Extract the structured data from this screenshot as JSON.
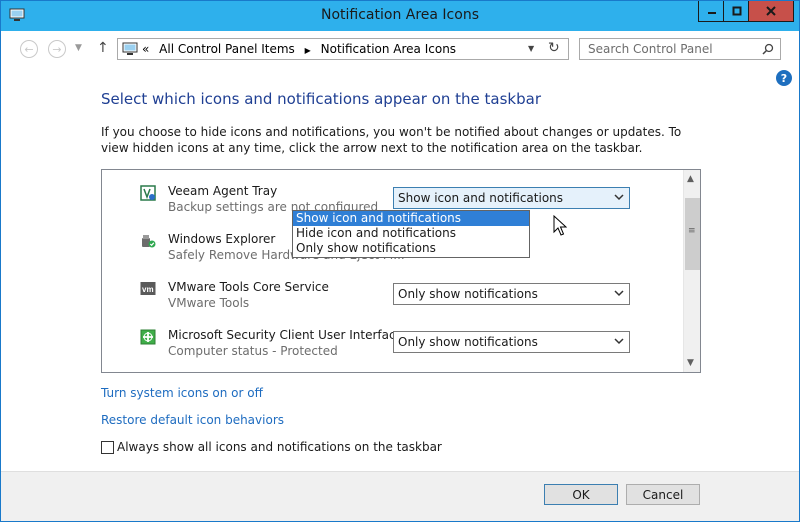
{
  "window": {
    "title": "Notification Area Icons",
    "controls": {
      "minimize": "minimize",
      "maximize": "maximize",
      "close": "close"
    }
  },
  "nav": {
    "breadcrumb_prefix": "«",
    "breadcrumb_root": "All Control Panel Items",
    "breadcrumb_sep": "▶",
    "breadcrumb_current": "Notification Area Icons",
    "search_placeholder": "Search Control Panel"
  },
  "help_label": "?",
  "heading": "Select which icons and notifications appear on the taskbar",
  "description": "If you choose to hide icons and notifications, you won't be notified about changes or updates. To view hidden icons at any time, click the arrow next to the notification area on the taskbar.",
  "items": [
    {
      "name": "Veeam Agent Tray",
      "subtitle": "Backup settings are not configured",
      "behavior": "Show icon and notifications",
      "icon": "veeam-icon"
    },
    {
      "name": "Windows Explorer",
      "subtitle": "Safely Remove Hardware and Eject M...",
      "behavior": "",
      "icon": "safely-remove-icon"
    },
    {
      "name": "VMware Tools Core Service",
      "subtitle": "VMware Tools",
      "behavior": "Only show notifications",
      "icon": "vmware-icon"
    },
    {
      "name": "Microsoft Security Client User Interface",
      "subtitle": "Computer status - Protected",
      "behavior": "Only show notifications",
      "icon": "security-client-icon"
    }
  ],
  "dropdown_options": [
    "Show icon and notifications",
    "Hide icon and notifications",
    "Only show notifications"
  ],
  "dropdown_highlighted": 0,
  "links": {
    "system_icons": "Turn system icons on or off",
    "restore_defaults": "Restore default icon behaviors"
  },
  "always_show": {
    "label": "Always show all icons and notifications on the taskbar",
    "checked": false
  },
  "footer": {
    "ok": "OK",
    "cancel": "Cancel"
  },
  "colors": {
    "titlebar": "#2eb0ec",
    "close": "#c7504a",
    "link": "#1e6cc0",
    "heading": "#1f3f93",
    "selection": "#2f7fd6"
  }
}
